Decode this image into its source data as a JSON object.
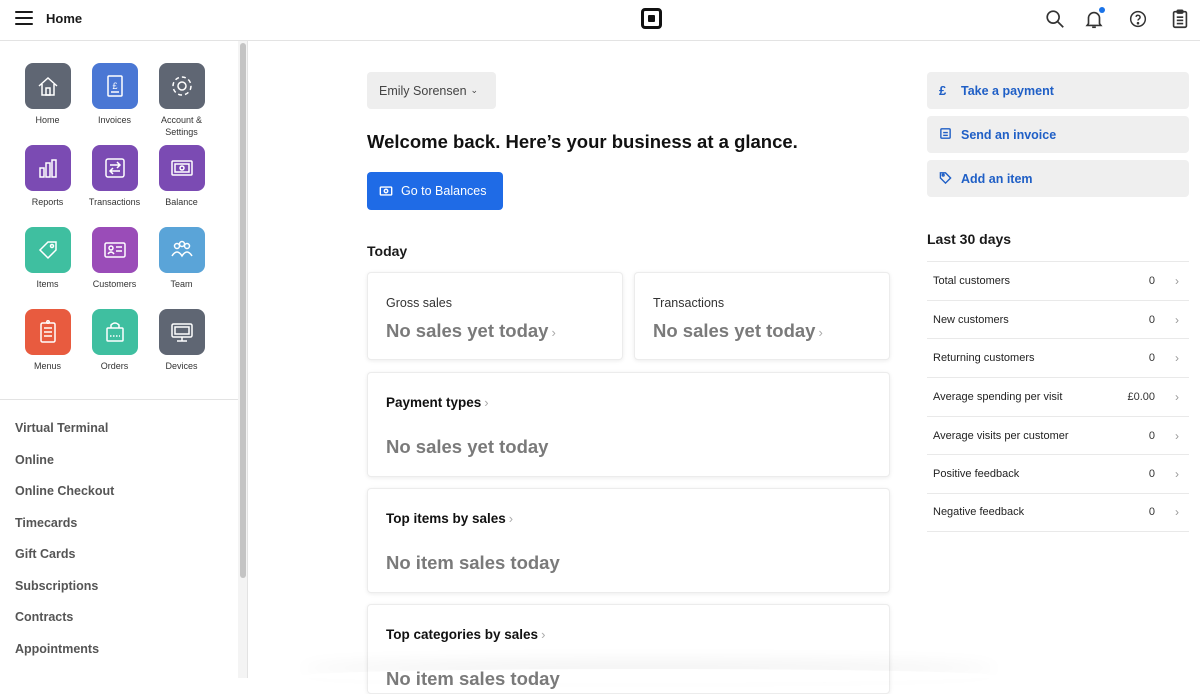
{
  "header": {
    "title": "Home"
  },
  "apps": [
    {
      "label": "Home",
      "color": "#5f6673",
      "icon": "house-icon"
    },
    {
      "label": "Invoices",
      "color": "#4a77d4",
      "icon": "invoice-icon"
    },
    {
      "label": "Account & Settings",
      "color": "#5f6673",
      "icon": "gear-icon"
    },
    {
      "label": "Reports",
      "color": "#7b4bb3",
      "icon": "bar-chart-icon"
    },
    {
      "label": "Transactions",
      "color": "#7b4bb3",
      "icon": "arrows-swap-icon"
    },
    {
      "label": "Balance",
      "color": "#7b4bb3",
      "icon": "banknote-icon"
    },
    {
      "label": "Items",
      "color": "#3fbfa0",
      "icon": "tag-icon"
    },
    {
      "label": "Customers",
      "color": "#9a4cb8",
      "icon": "contact-card-icon"
    },
    {
      "label": "Team",
      "color": "#5aa4d8",
      "icon": "people-icon"
    },
    {
      "label": "Menus",
      "color": "#e85b3f",
      "icon": "menu-icon"
    },
    {
      "label": "Orders",
      "color": "#3fbfa0",
      "icon": "shopping-bag-icon"
    },
    {
      "label": "Devices",
      "color": "#5f6673",
      "icon": "monitor-icon"
    }
  ],
  "sidebar_links": [
    "Virtual Terminal",
    "Online",
    "Online Checkout",
    "Timecards",
    "Gift Cards",
    "Subscriptions",
    "Contracts",
    "Appointments"
  ],
  "main": {
    "user": "Emily Sorensen",
    "welcome": "Welcome back. Here’s your business at a glance.",
    "balances_button": "Go to Balances",
    "today": "Today",
    "gross_sales": {
      "label": "Gross sales",
      "value": "No sales yet today"
    },
    "transactions": {
      "label": "Transactions",
      "value": "No sales yet today"
    },
    "payment_types": {
      "title": "Payment types",
      "value": "No sales yet today"
    },
    "top_items": {
      "title": "Top items by sales",
      "value": "No item sales today"
    },
    "top_categories": {
      "title": "Top categories by sales",
      "value": "No item sales today"
    }
  },
  "actions": {
    "take_payment": "Take a payment",
    "send_invoice": "Send an invoice",
    "add_item": "Add an item",
    "pound_symbol": "£"
  },
  "last30": {
    "title": "Last 30 days",
    "rows": [
      {
        "label": "Total customers",
        "value": "0"
      },
      {
        "label": "New customers",
        "value": "0"
      },
      {
        "label": "Returning customers",
        "value": "0"
      },
      {
        "label": "Average spending per visit",
        "value": "£0.00"
      },
      {
        "label": "Average visits per customer",
        "value": "0"
      },
      {
        "label": "Positive feedback",
        "value": "0"
      },
      {
        "label": "Negative feedback",
        "value": "0"
      }
    ]
  },
  "colors": {
    "primary": "#1f6be6",
    "link": "#1f5fc6",
    "notification": "#1a73e8"
  }
}
